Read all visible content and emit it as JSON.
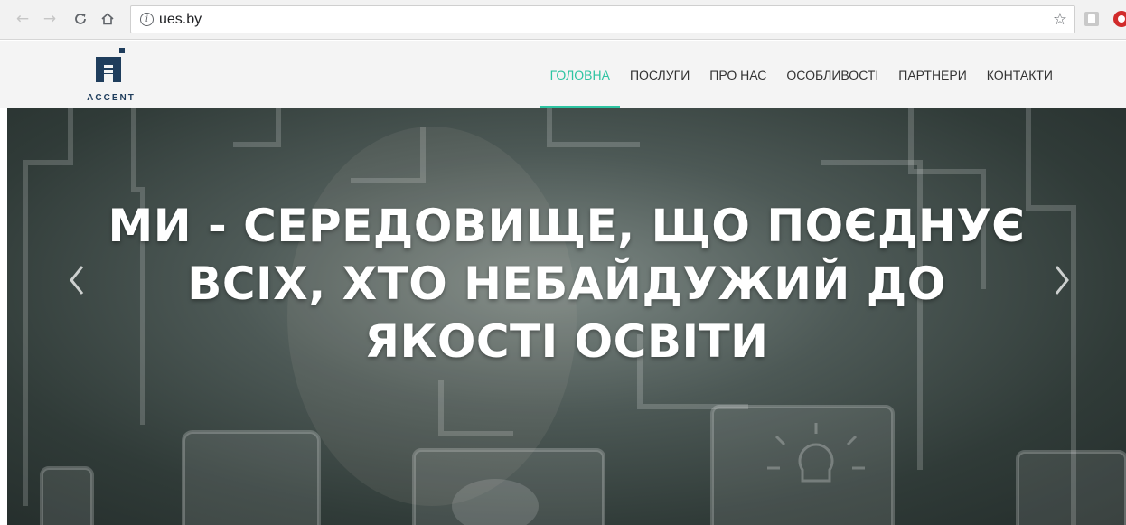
{
  "browser": {
    "back_icon": "arrow-left-icon",
    "forward_icon": "arrow-right-icon",
    "reload_icon": "reload-icon",
    "home_icon": "home-icon",
    "url": "ues.by",
    "bookmark_icon": "star-icon"
  },
  "site": {
    "logo_text": "ACCENT",
    "brand_color": "#1f3d5c",
    "accent_color": "#2ec4a2",
    "menu": [
      {
        "label": "ГОЛОВНА",
        "active": true
      },
      {
        "label": "ПОСЛУГИ",
        "active": false
      },
      {
        "label": "ПРО НАС",
        "active": false
      },
      {
        "label": "ОСОБЛИВОСТІ",
        "active": false
      },
      {
        "label": "ПАРТНЕРИ",
        "active": false
      },
      {
        "label": "КОНТАКТИ",
        "active": false
      }
    ]
  },
  "hero": {
    "title_lines": [
      "МИ - СЕРЕДОВИЩЕ, ЩО ПОЄДНУЄ",
      "ВСІХ, ХТО НЕБАЙДУЖИЙ ДО",
      "ЯКОСТІ ОСВІТИ"
    ],
    "prev_icon": "chevron-left-icon",
    "next_icon": "chevron-right-icon"
  }
}
